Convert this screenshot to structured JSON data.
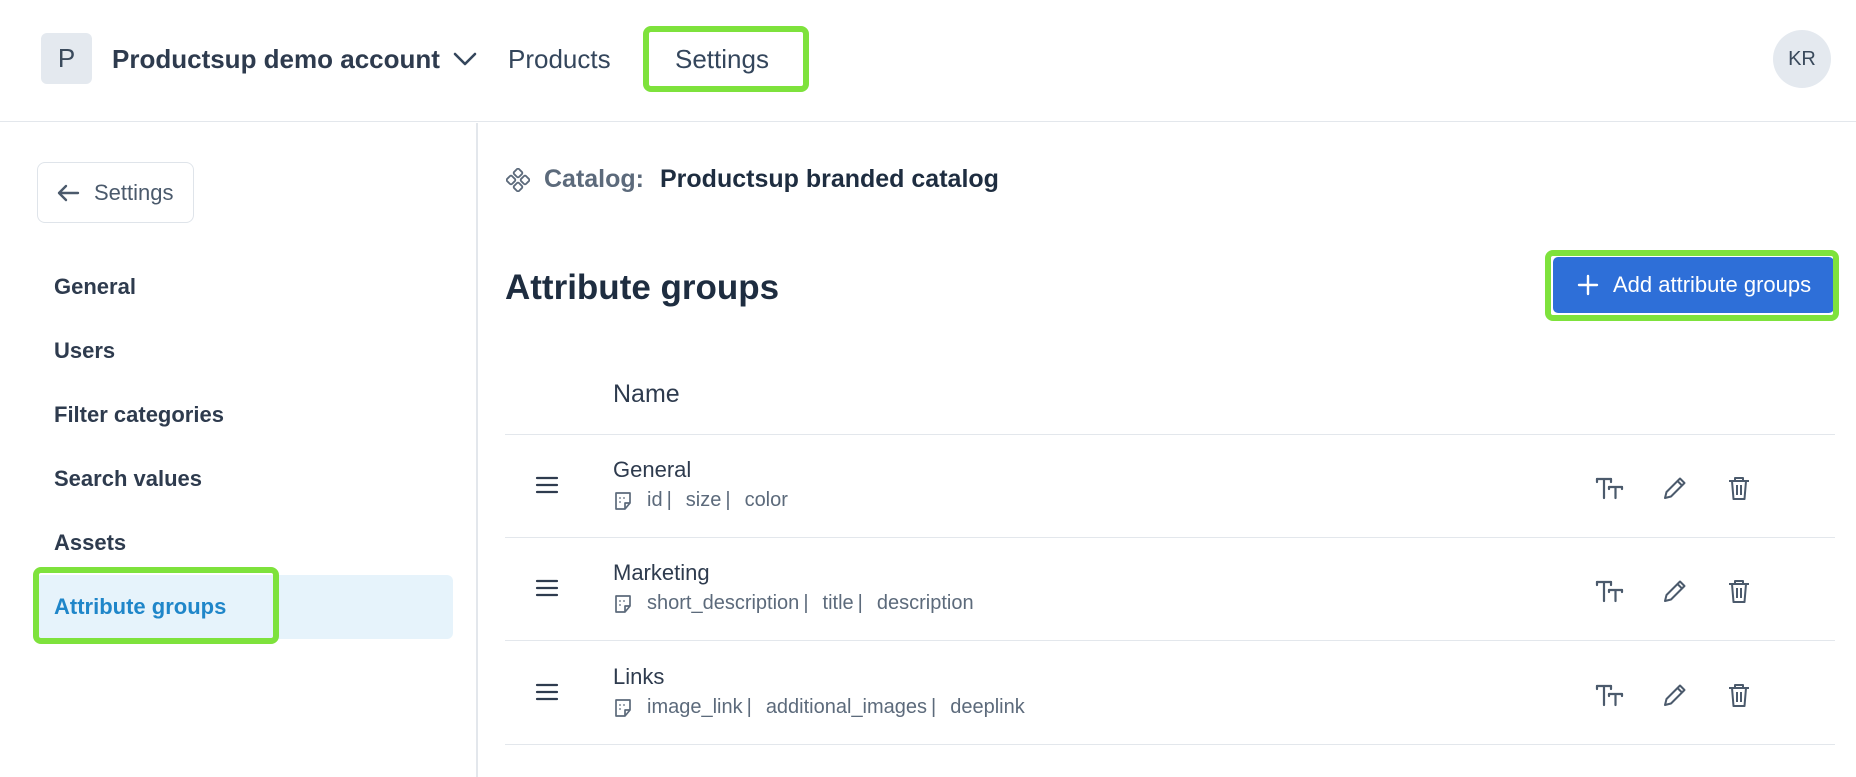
{
  "topbar": {
    "account_initial": "P",
    "account_name": "Productsup demo account",
    "nav": {
      "products": "Products",
      "settings": "Settings"
    },
    "user_initials": "KR"
  },
  "sidebar": {
    "back_label": "Settings",
    "items": [
      {
        "label": "General"
      },
      {
        "label": "Users"
      },
      {
        "label": "Filter categories"
      },
      {
        "label": "Search values"
      },
      {
        "label": "Assets"
      },
      {
        "label": "Attribute groups",
        "active": true
      }
    ]
  },
  "main": {
    "catalog_label": "Catalog:",
    "catalog_name": "Productsup branded catalog",
    "title": "Attribute groups",
    "add_button": "Add attribute groups",
    "column_name": "Name",
    "rows": [
      {
        "name": "General",
        "attrs": [
          "id",
          "size",
          "color"
        ]
      },
      {
        "name": "Marketing",
        "attrs": [
          "short_description",
          "title",
          "description"
        ]
      },
      {
        "name": "Links",
        "attrs": [
          "image_link",
          "additional_images",
          "deeplink"
        ]
      }
    ]
  },
  "colors": {
    "highlight": "#7ee23c",
    "primary_button": "#2e6fd8",
    "active_nav_bg": "#e6f3fb",
    "active_nav_text": "#1f86c9"
  },
  "separator": "|",
  "icons": [
    "chevron-down-icon",
    "arrow-left-icon",
    "catalog-icon",
    "plus-icon",
    "drag-handle-icon",
    "text-format-icon",
    "pencil-icon",
    "trash-icon"
  ]
}
